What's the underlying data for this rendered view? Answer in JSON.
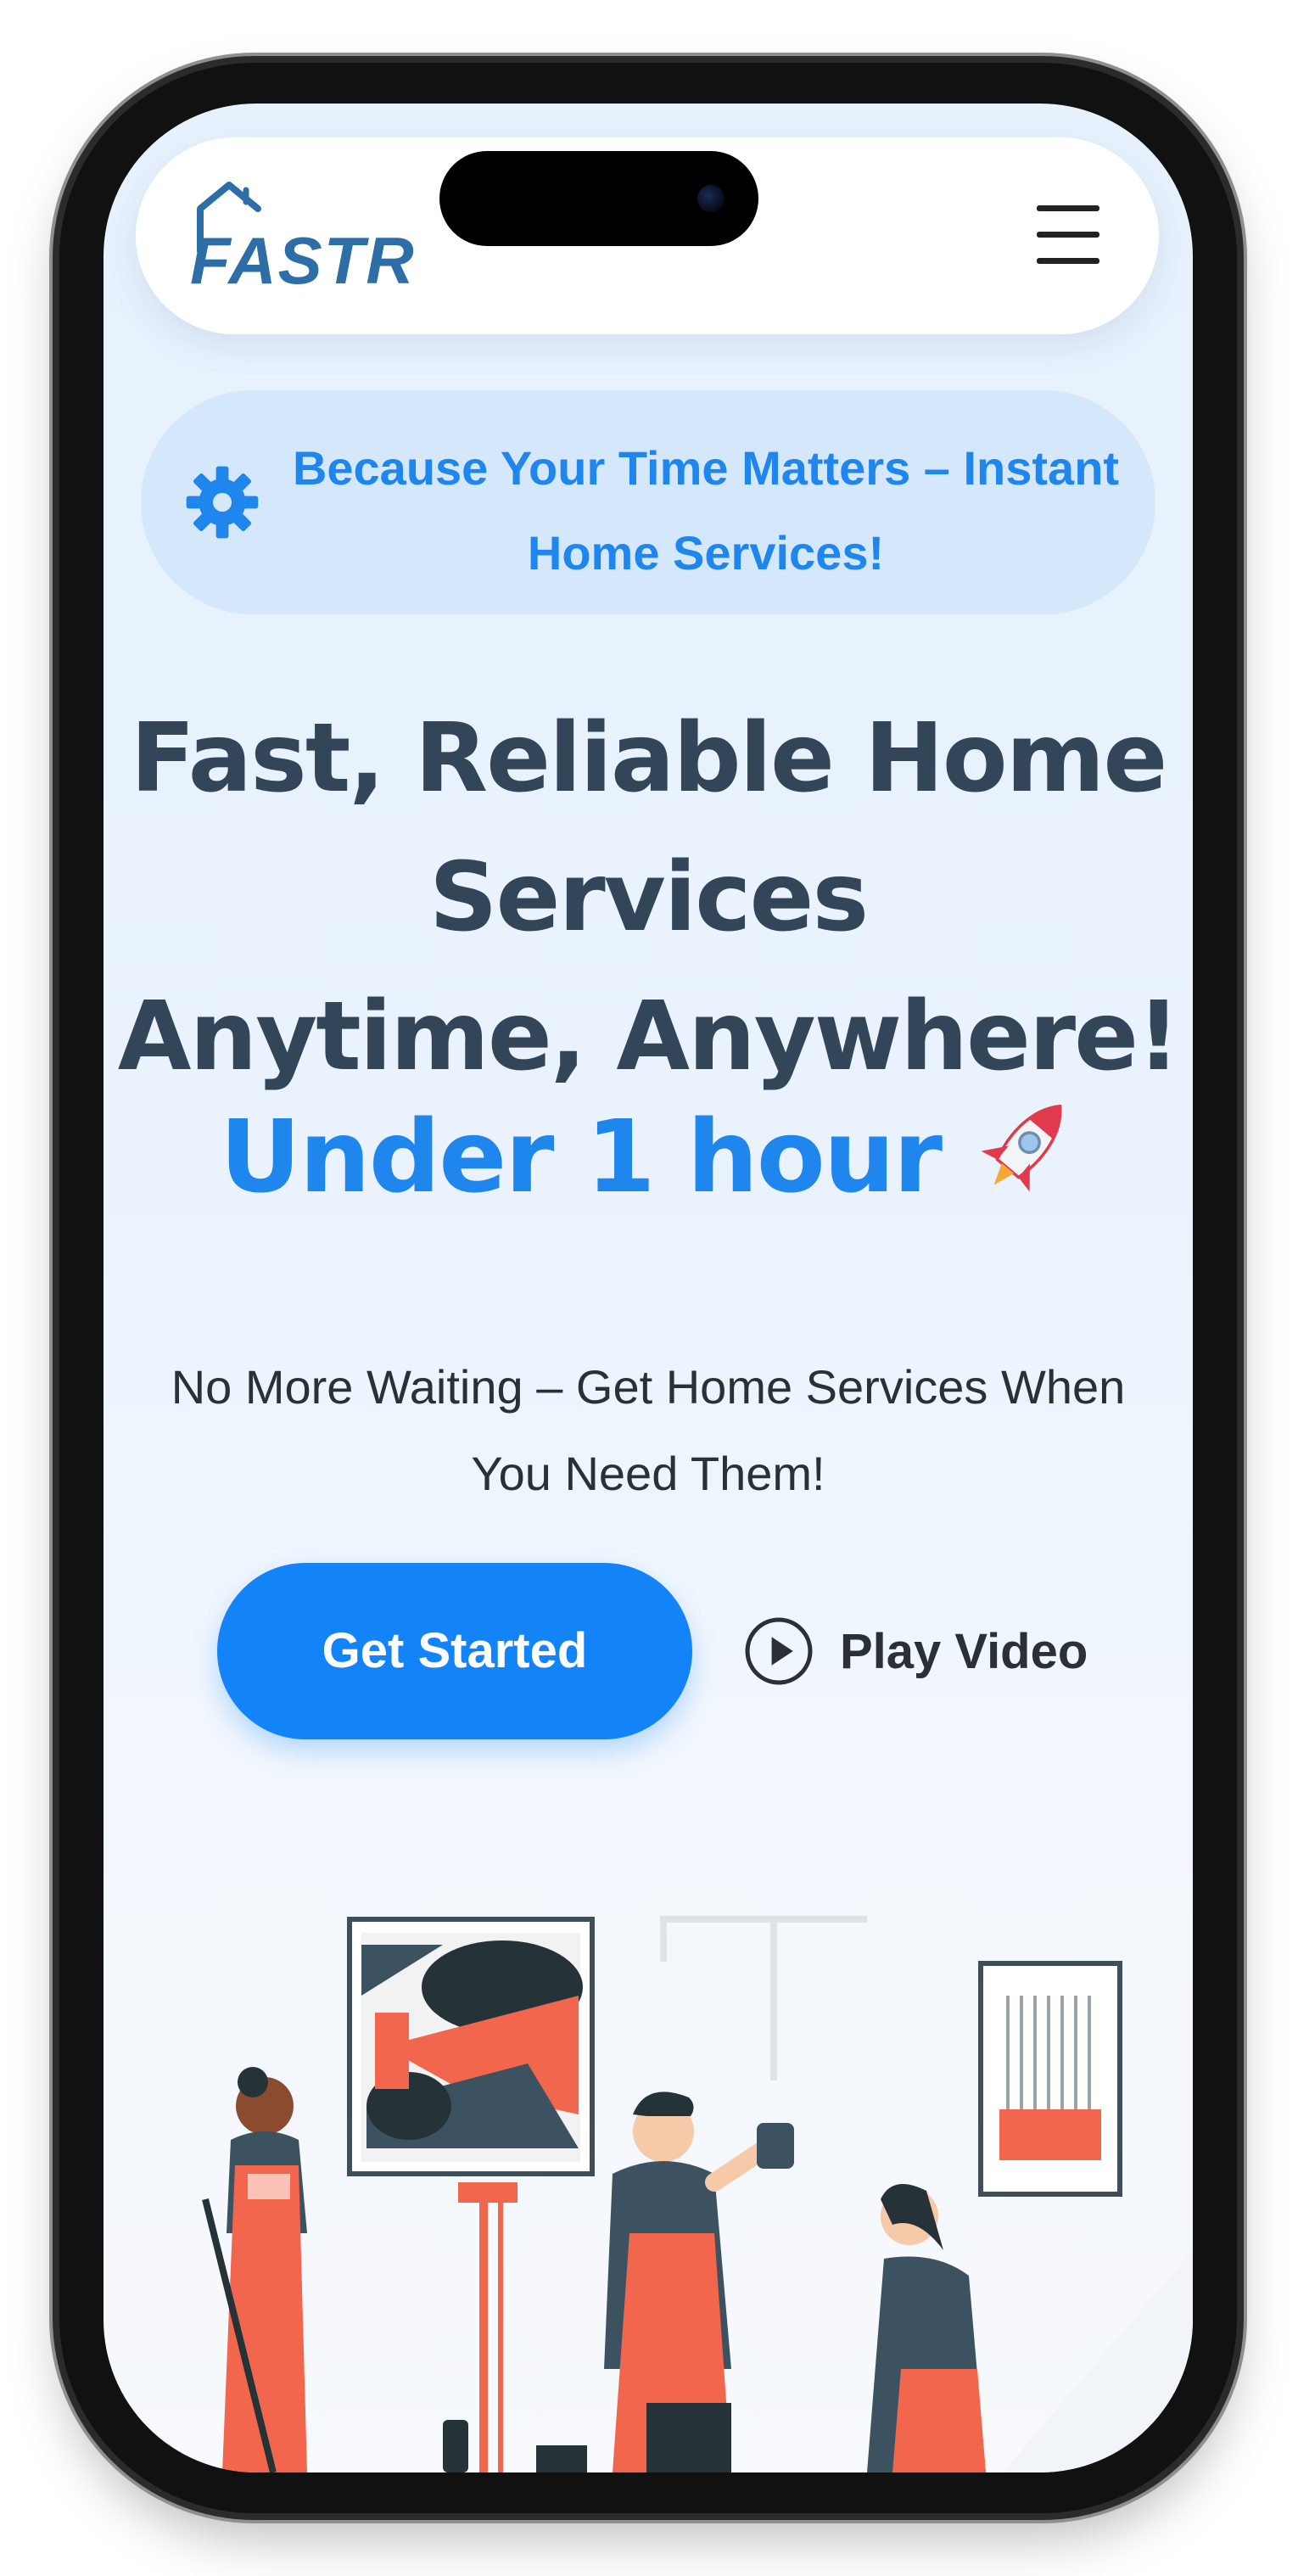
{
  "header": {
    "logo_text": "FASTR",
    "menu_icon": "hamburger-menu-icon"
  },
  "banner": {
    "icon": "gear-icon",
    "text": "Because Your Time Matters – Instant Home Services!"
  },
  "hero": {
    "title_line1": "Fast, Reliable Home",
    "title_line2": "Services",
    "title_line3": "Anytime, Anywhere!",
    "accent": "Under 1 hour",
    "accent_icon": "rocket-icon",
    "subtitle": "No More Waiting – Get Home Services When You Need Them!"
  },
  "actions": {
    "primary_label": "Get Started",
    "video_label": "Play Video",
    "video_icon": "play-circle-icon"
  },
  "colors": {
    "brand_blue": "#1384f7",
    "banner_text": "#1f86ee",
    "heading": "#334558",
    "banner_bg": "#d5e7fb"
  }
}
